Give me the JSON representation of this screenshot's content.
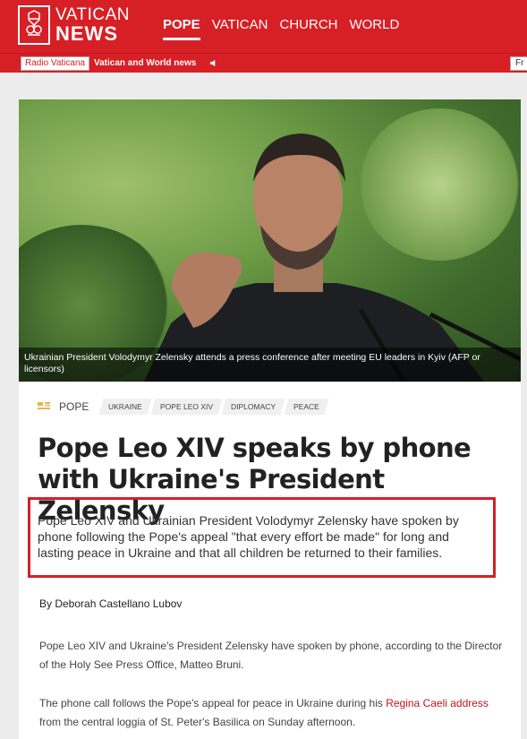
{
  "brand": {
    "top": "VATICAN",
    "bottom": "NEWS"
  },
  "nav": {
    "items": [
      "POPE",
      "VATICAN",
      "CHURCH",
      "WORLD"
    ],
    "active": "POPE"
  },
  "radio": {
    "button": "Radio Vaticana",
    "program": "Vatican and World news",
    "right_button": "Fr"
  },
  "hero": {
    "caption": "Ukrainian President Volodymyr Zelensky attends a press conference after meeting EU leaders in Kyiv  (AFP or licensors)"
  },
  "tags": {
    "section": "POPE",
    "items": [
      "UKRAINE",
      "POPE LEO XIV",
      "DIPLOMACY",
      "PEACE"
    ]
  },
  "article": {
    "headline": "Pope Leo XIV speaks by phone with Ukraine's President Zelensky",
    "intro": "Pope Leo XIV and Ukrainian President Volodymyr Zelensky have spoken by phone following the Pope's appeal \"that every effort be made\" for long and lasting peace in Ukraine and that all children be returned to their families.",
    "byline": "By Deborah Castellano Lubov",
    "p1": "Pope Leo XIV and Ukraine's President Zelensky have spoken by phone, according to the Director of the Holy See Press Office, Matteo Bruni.",
    "p2_before": "The phone call follows the Pope's appeal for peace in Ukraine during his ",
    "p2_link": "Regina Caeli address",
    "p2_after": " from the central loggia of St. Peter's Basilica on Sunday afternoon."
  },
  "colors": {
    "brand_red": "#d71f26",
    "link_red": "#c0141b",
    "highlight_box": "#d71f26"
  }
}
